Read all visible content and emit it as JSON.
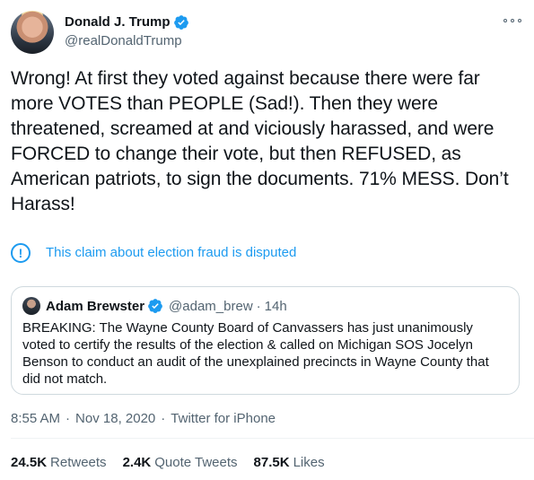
{
  "author": {
    "display_name": "Donald J. Trump",
    "handle": "@realDonaldTrump",
    "verified": true
  },
  "tweet": {
    "text": "Wrong! At first they voted against because there were far more VOTES than PEOPLE (Sad!). Then they were threatened, screamed at and viciously harassed, and were FORCED to change their vote, but then REFUSED, as American patriots, to sign the documents. 71% MESS. Don’t Harass!"
  },
  "notice": {
    "icon": "exclamation-circle-icon",
    "text": "This claim about election fraud is disputed"
  },
  "quoted_tweet": {
    "display_name": "Adam Brewster",
    "handle": "@adam_brew",
    "separator": "·",
    "time": "14h",
    "verified": true,
    "text": "BREAKING: The Wayne County Board of Canvassers has just unanimously voted to certify the results of the election & called on Michigan SOS Jocelyn Benson to conduct an audit of the unexplained precincts in Wayne County that did not match."
  },
  "meta": {
    "time": "8:55 AM",
    "date": "Nov 18, 2020",
    "source": "Twitter for iPhone",
    "separator": "·"
  },
  "stats": {
    "retweets_count": "24.5K",
    "retweets_label": "Retweets",
    "quotes_count": "2.4K",
    "quotes_label": "Quote Tweets",
    "likes_count": "87.5K",
    "likes_label": "Likes"
  },
  "colors": {
    "accent": "#1d9bf0",
    "secondary_text": "#536471",
    "border": "#cfd9de"
  }
}
